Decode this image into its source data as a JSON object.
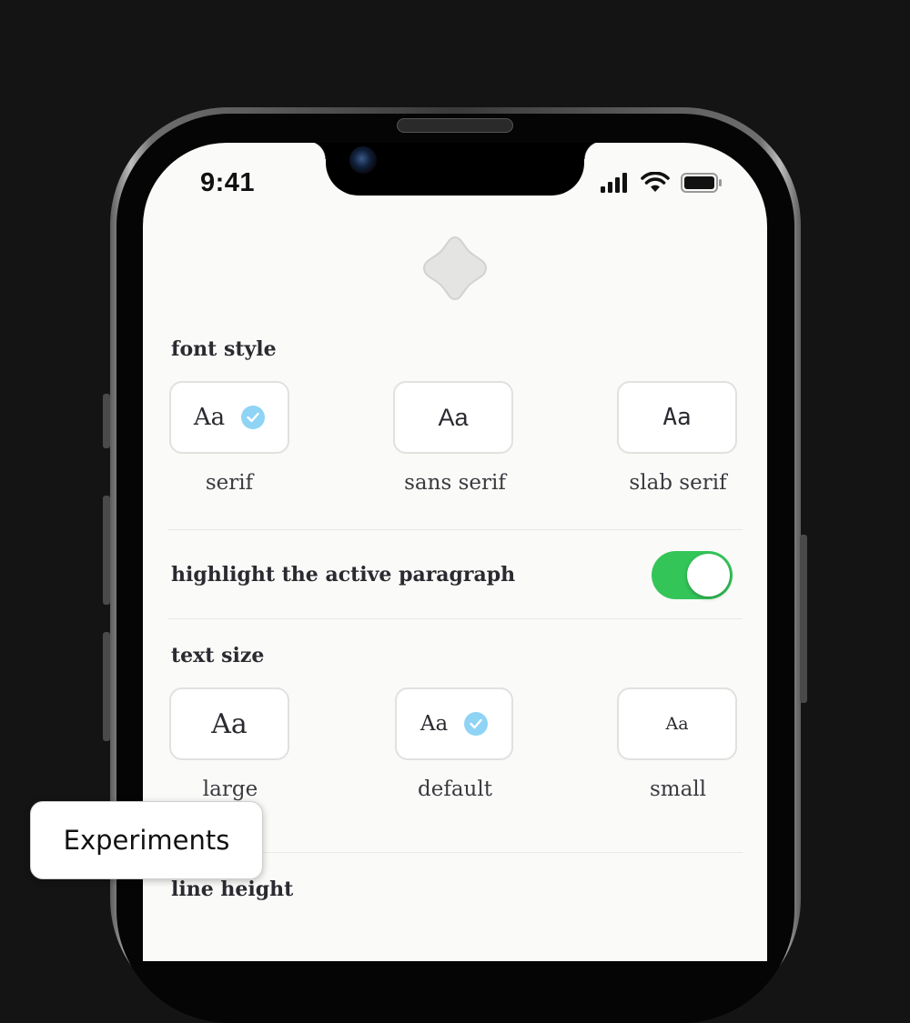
{
  "status_bar": {
    "time": "9:41",
    "icons": [
      "cellular-signal-icon",
      "wifi-icon",
      "battery-icon"
    ]
  },
  "app_logo_icon": "sparkle-star-icon",
  "font_style": {
    "label": "font style",
    "selected": "serif",
    "options": [
      {
        "sample": "Aa",
        "caption": "serif",
        "selected": true
      },
      {
        "sample": "Aa",
        "caption": "sans serif",
        "selected": false
      },
      {
        "sample": "Aa",
        "caption": "slab serif",
        "selected": false
      }
    ]
  },
  "highlight": {
    "label": "highlight the active paragraph",
    "enabled": true
  },
  "text_size": {
    "label": "text size",
    "selected": "default",
    "options": [
      {
        "sample": "Aa",
        "caption": "large",
        "selected": false
      },
      {
        "sample": "Aa",
        "caption": "default",
        "selected": true
      },
      {
        "sample": "Aa",
        "caption": "small",
        "selected": false
      }
    ]
  },
  "line_height": {
    "label": "line height"
  },
  "chip": {
    "label": "Experiments"
  },
  "colors": {
    "background": "#141414",
    "screen": "#fafaf8",
    "toggle_on": "#34c559",
    "check": "#8fd3f5",
    "text": "#2a2a30"
  }
}
